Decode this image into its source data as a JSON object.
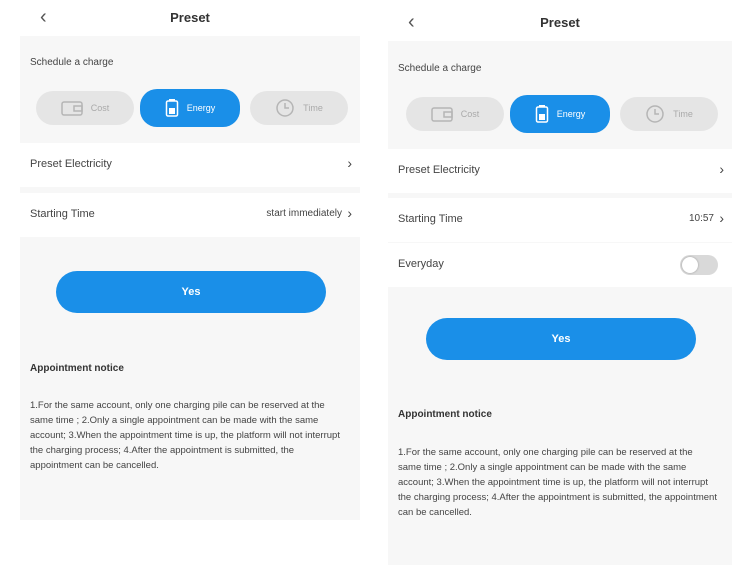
{
  "accent_color": "#1a8fe8",
  "screens": [
    {
      "back_icon": "chevron-left-icon",
      "title": "Preset",
      "schedule_label": "Schedule a charge",
      "segments": [
        {
          "label": "Cost",
          "icon": "wallet-icon",
          "active": false
        },
        {
          "label": "Energy",
          "icon": "battery-icon",
          "active": true
        },
        {
          "label": "Time",
          "icon": "clock-icon",
          "active": false
        }
      ],
      "preset_electricity_label": "Preset Electricity",
      "chevron": "›",
      "starting_time_label": "Starting Time",
      "starting_time_value": "start immediately",
      "yes_label": "Yes",
      "notice_title": "Appointment notice",
      "notice_text": "1.For the same account, only one charging pile can be reserved at the same time ; 2.Only a single appointment can be made with the same account; 3.When the appointment time is up, the platform will not interrupt the charging process; 4.After the appointment is submitted, the appointment can be cancelled."
    },
    {
      "back_icon": "chevron-left-icon",
      "title": "Preset",
      "schedule_label": "Schedule a charge",
      "segments": [
        {
          "label": "Cost",
          "icon": "wallet-icon",
          "active": false
        },
        {
          "label": "Energy",
          "icon": "battery-icon",
          "active": true
        },
        {
          "label": "Time",
          "icon": "clock-icon",
          "active": false
        }
      ],
      "preset_electricity_label": "Preset Electricity",
      "chevron": "›",
      "starting_time_label": "Starting Time",
      "starting_time_value": "10:57",
      "everyday_label": "Everyday",
      "everyday_on": false,
      "yes_label": "Yes",
      "notice_title": "Appointment notice",
      "notice_text": "1.For the same account, only one charging pile can be reserved at the same time ; 2.Only a single appointment can be made with the same account; 3.When the appointment time is up, the platform will not interrupt the charging process; 4.After the appointment is submitted, the appointment can be cancelled."
    }
  ]
}
